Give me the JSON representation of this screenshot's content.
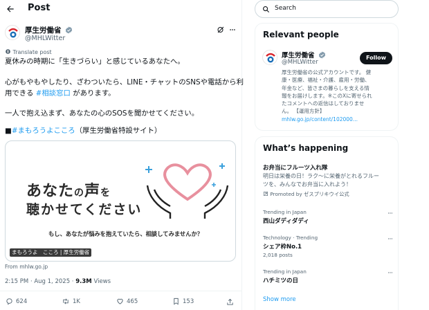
{
  "header": {
    "title": "Post"
  },
  "post": {
    "author_name": "厚生労働省",
    "author_handle": "@MHLWitter",
    "translate_label": "Translate post",
    "lines": {
      "l1": "夏休みの時期に「生きづらい」と感じているあなたへ。",
      "l2": "心がもやもやしたり、ざわついたら、LINE・チャットのSNSや電話から利",
      "l3a": "用できる ",
      "l3_link": "#相談窓口",
      "l3b": " があります。",
      "l4": "一人で抱え込まず、あなたの心のSOSを聞かせてください。",
      "l5_prefix": "■",
      "l5_link": "#まもろうよこころ",
      "l5_suffix": "（厚生労働省特設サイト）"
    },
    "card": {
      "headline_a": "あなた",
      "headline_no": "の",
      "headline_b": "声",
      "headline_wo": "を",
      "headline_line2": "聴かせてください",
      "subtitle": "もし、あなたが悩みを抱えていたら、相談してみませんか？",
      "badge_a": "まもろうよ　こころ",
      "badge_b": "厚生労働省",
      "source": "From mhlw.go.jp"
    },
    "time": "2:15 PM · Aug 1, 2025 · ",
    "views_count": "9.3M",
    "views_label": " Views",
    "actions": {
      "replies": "624",
      "reposts": "1K",
      "likes": "465",
      "bookmarks": "153"
    }
  },
  "sidebar": {
    "search_placeholder": "Search",
    "relevant": {
      "title": "Relevant people",
      "name": "厚生労働省",
      "handle": "@MHLWitter",
      "follow_label": "Follow",
      "bio": [
        "厚生労働省の公式アカウントです。 健",
        "康・医療、福祉・介護、雇用・労働、",
        "年金など、皆さまの暮らしを支える情",
        "報をお届けします。※このXに寄せられ",
        "たコメントへの返信はしておりませ",
        "ん。 【運用方針】"
      ],
      "bio_link": "mhlw.go.jp/content/102000..."
    },
    "happening": {
      "title": "What’s happening",
      "promo_title": "お弁当にフルーツ入れ隊",
      "promo_desc": [
        "明日は栄養の日！ラク〜に栄養がとれるフルー",
        "ツを、みんなでお弁当に入れよう！"
      ],
      "promo_by": "Promoted by ゼスプリキウイ公式",
      "trends": [
        {
          "meta": "Trending in Japan",
          "name": "西山ダディダディ",
          "posts": ""
        },
        {
          "meta": "Technology · Trending",
          "name": "シェア枠No.1",
          "posts": "2,018 posts"
        },
        {
          "meta": "Trending in Japan",
          "name": "ハチミツの日",
          "posts": ""
        }
      ],
      "show_more": "Show more"
    }
  },
  "colors": {
    "accent": "#1d9bf0",
    "heart": "#e8909e",
    "sparkle": "#3aa0dc"
  }
}
